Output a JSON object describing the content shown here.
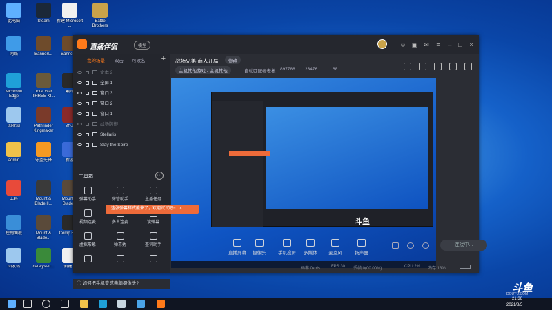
{
  "desktop": {
    "icons": [
      {
        "label": "此电脑",
        "color": "#5fb0ff"
      },
      {
        "label": "Steam",
        "color": "#1b2838"
      },
      {
        "label": "新建 Microsoft ...",
        "color": "#f0f0f0"
      },
      {
        "label": "Battle Brothers",
        "color": "#c9a34a"
      },
      {
        "label": "网络",
        "color": "#3f9be8"
      },
      {
        "label": "Bannerl...",
        "color": "#6e4b2b"
      },
      {
        "label": "Bannerl...",
        "color": "#6e4b2b"
      },
      {
        "label": "Microsoft Edge",
        "color": "#1fa0d8"
      },
      {
        "label": "Total War THREE KI...",
        "color": "#6a5a3a"
      },
      {
        "label": "最终",
        "color": "#2a2a2a"
      },
      {
        "label": "回收站",
        "color": "#9dc8ee"
      },
      {
        "label": "Pathfinder Kingmaker",
        "color": "#7a3a2a"
      },
      {
        "label": "对决",
        "color": "#8a2a2a"
      },
      {
        "label": "admin",
        "color": "#f0c24a"
      },
      {
        "label": "守望先锋",
        "color": "#f59a23"
      },
      {
        "label": "新游",
        "color": "#3a6ad8"
      },
      {
        "label": "工具",
        "color": "#e84a3a"
      },
      {
        "label": "Mount & Blade II...",
        "color": "#3a3a3a"
      },
      {
        "label": "Mount & Blade...",
        "color": "#5a4a3a"
      },
      {
        "label": "控制面板",
        "color": "#3a8ed8"
      },
      {
        "label": "Mount & Blade...",
        "color": "#5a4a3a"
      },
      {
        "label": "Comp Hero",
        "color": "#2a2a2a"
      },
      {
        "label": "回收站",
        "color": "#9dc8ee"
      },
      {
        "label": "catalyst-II...",
        "color": "#3a8a3a"
      },
      {
        "label": "新建...",
        "color": "#f0f0f0"
      }
    ]
  },
  "app": {
    "name": "直播伴侣",
    "mode_badge": "横型",
    "titlebar_icons": [
      "smiley-icon",
      "gift-icon",
      "mail-icon",
      "menu-icon",
      "minimize-icon",
      "maximize-icon",
      "close-icon"
    ],
    "scene_tabs": [
      "我的场景",
      "双击",
      "可改名"
    ],
    "sources": [
      {
        "label": "文本 2",
        "dim": true
      },
      {
        "label": "全屏 1",
        "dim": false
      },
      {
        "label": "窗口 3",
        "dim": false
      },
      {
        "label": "窗口 2",
        "dim": false
      },
      {
        "label": "窗口 1",
        "dim": false
      },
      {
        "label": "战场防御",
        "dim": true
      },
      {
        "label": "Stellaris",
        "dim": false
      },
      {
        "label": "Slay the Spire",
        "dim": false
      }
    ],
    "tools_header": "工具箱",
    "tools_more": "···",
    "tools": [
      {
        "label": "弹幕助手"
      },
      {
        "label": "房管助手"
      },
      {
        "label": "主播任务"
      },
      {
        "label": "视频连麦"
      },
      {
        "label": "多人连麦"
      },
      {
        "label": "读弹幕"
      },
      {
        "label": "虚拟形象"
      },
      {
        "label": "弹幕秀"
      },
      {
        "label": "查词助手"
      },
      {
        "label": ""
      },
      {
        "label": ""
      },
      {
        "label": ""
      }
    ],
    "toast": "这张弹幕样式能来了，欢迎试试吧~",
    "toast_close": "×",
    "tip": "如何把手机变成电脑摄像头?",
    "stream_title": "战场兄弟-商人开局",
    "edit_label": "修改",
    "category": "主机其他游戏 - 主机其他",
    "stat_tag": "自动匹配者老板",
    "stat_viewers": "897788",
    "stat_hot": "23476",
    "stat_fans": "68",
    "controls": [
      {
        "label": "直播屏幕"
      },
      {
        "label": "摄像头"
      },
      {
        "label": "手机投屏"
      },
      {
        "label": "多媒体"
      },
      {
        "label": "麦克风"
      },
      {
        "label": "扬声器"
      }
    ],
    "go_live": "连接中...",
    "status": {
      "bitrate": "码率:0kb/s",
      "fps": "FPS:30",
      "drop": "丢帧:0(00.00%)",
      "cpu": "CPU:2%",
      "mem": "内存:13%"
    },
    "watermark": "斗鱼"
  },
  "taskbar": {
    "icons": [
      "windows-icon",
      "search-icon",
      "cortana-icon",
      "task-view-icon",
      "explorer-icon",
      "edge-icon",
      "steam-icon",
      "browser-icon",
      "live-companion-icon"
    ],
    "time": "21:36",
    "date": "2021/8/5"
  },
  "overlay": {
    "logo": "斗鱼",
    "url": "DOUYU.COM"
  }
}
